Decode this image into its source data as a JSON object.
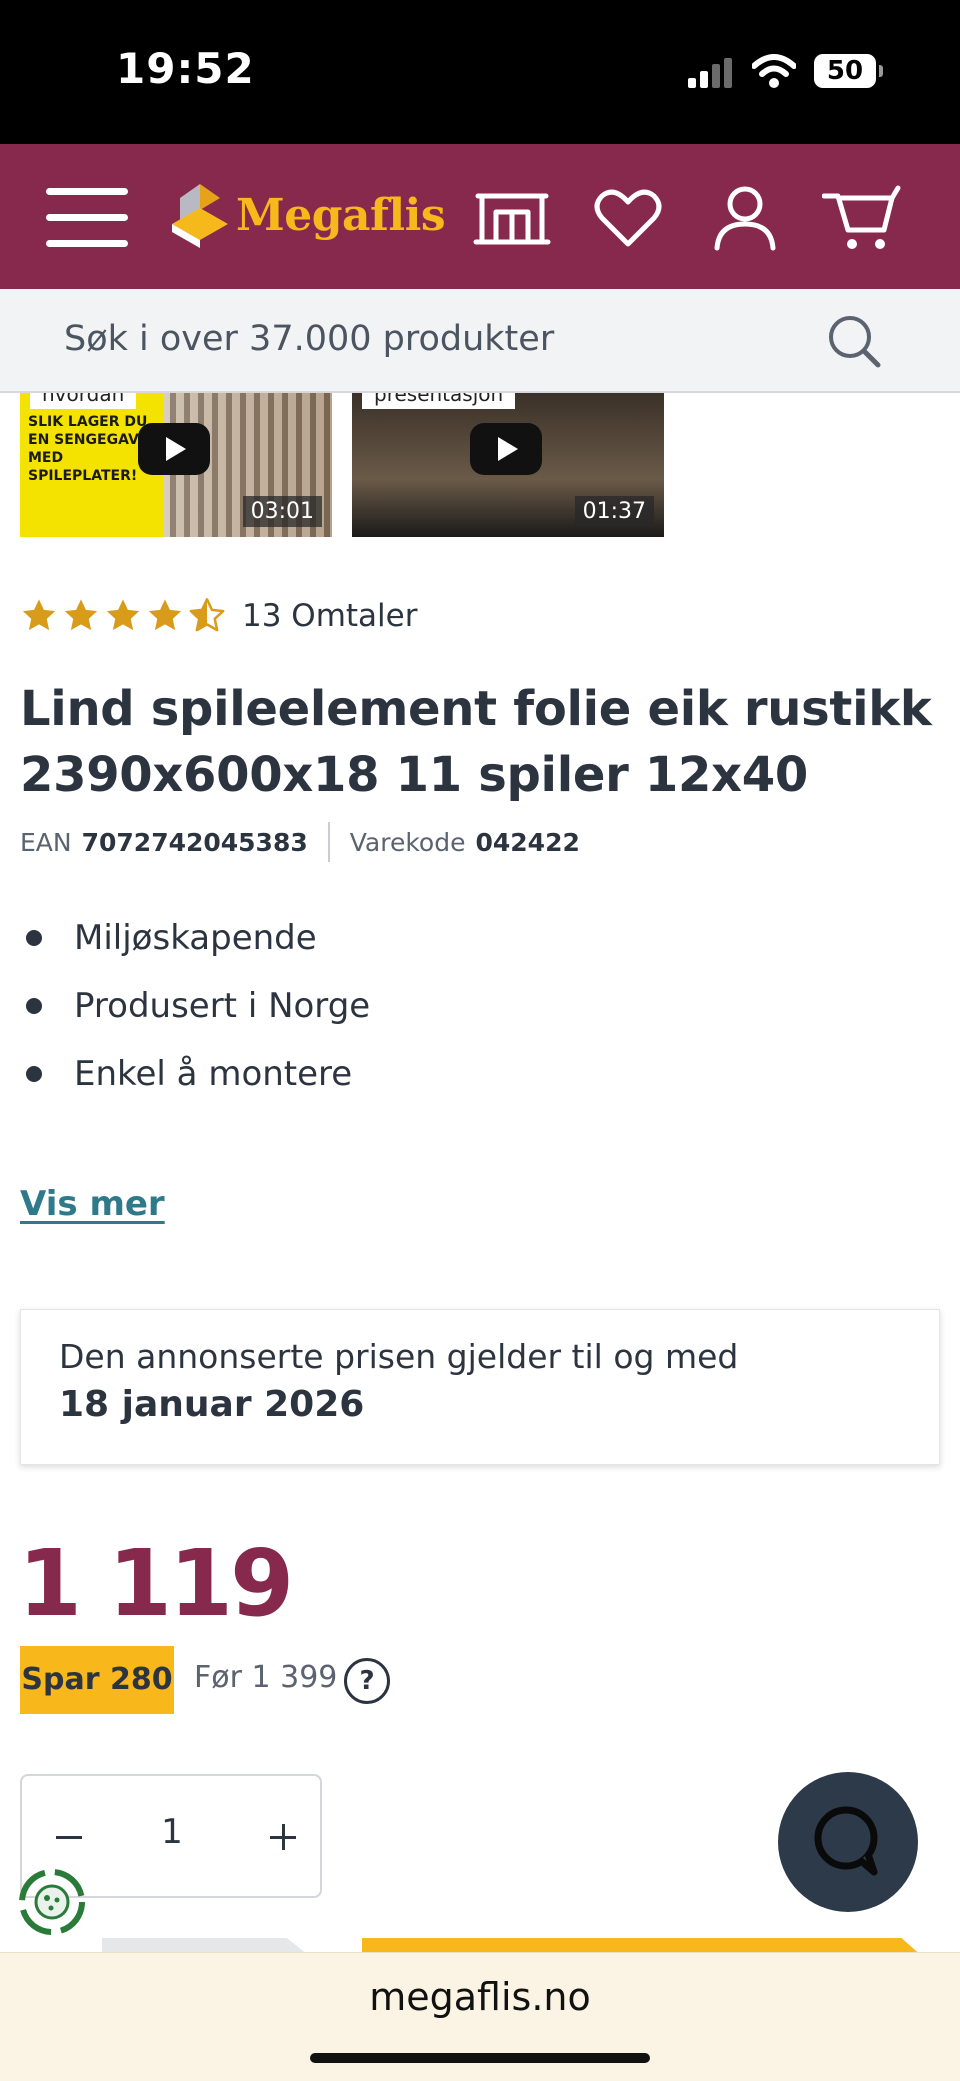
{
  "status_bar": {
    "time": "19:52",
    "battery": "50"
  },
  "header": {
    "logo_text": "Megaflis",
    "icons": [
      "menu-icon",
      "store-icon",
      "heart-icon",
      "user-icon",
      "cart-icon"
    ],
    "brand_color": "#86294c",
    "accent_color": "#f6b91c"
  },
  "search": {
    "placeholder": "Søk i over 37.000 produkter"
  },
  "videos": [
    {
      "tag": "hvordan",
      "overlay_text": "SLIK LAGER DU EN SENGEGAVL MED SPILEPLATER!",
      "duration": "03:01"
    },
    {
      "tag": "presentasjon",
      "duration": "01:37"
    }
  ],
  "rating": {
    "stars": 4.5,
    "max": 5,
    "count_text": "13 Omtaler"
  },
  "product": {
    "title": "Lind spileelement folie eik rustikk 2390x600x18 11 spiler 12x40",
    "ean_label": "EAN",
    "ean": "7072742045383",
    "sku_label": "Varekode",
    "sku": "042422",
    "features": [
      "Miljøskapende",
      "Produsert i Norge",
      "Enkel å montere"
    ],
    "show_more": "Vis mer"
  },
  "notice": {
    "line1": "Den annonserte prisen gjelder til og med",
    "line2": "18 januar 2026"
  },
  "price": {
    "current": "1 119",
    "save_badge": "Spar 280",
    "before": "Før 1 399",
    "help": "?"
  },
  "quantity": {
    "value": "1"
  },
  "browser": {
    "url": "megaflis.no"
  }
}
